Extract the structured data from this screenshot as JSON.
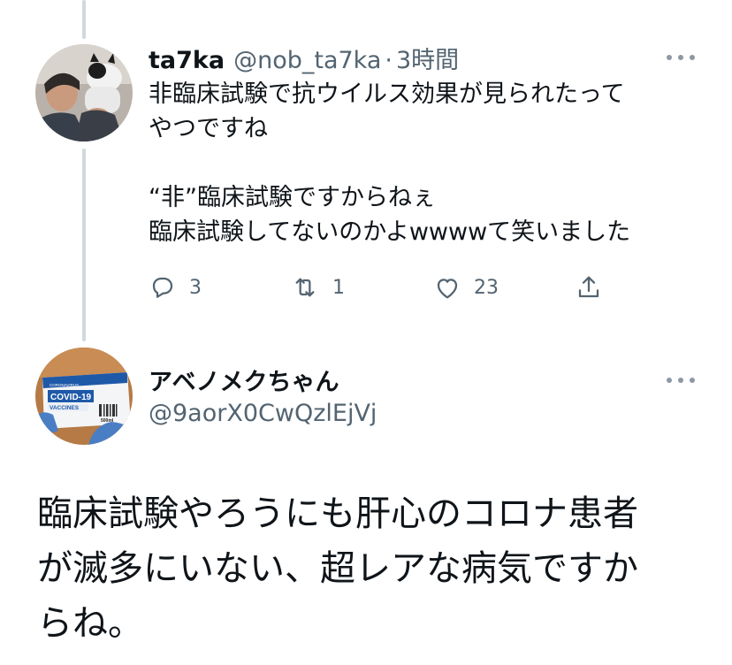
{
  "reply": {
    "display_name": "ta7ka",
    "handle": "@nob_ta7ka",
    "separator": "·",
    "time": "3時間",
    "text_lines": [
      "非臨床試験で抗ウイルス効果が見られたって",
      "やつですね",
      "",
      "“非”臨床試験ですからねぇ",
      "臨床試験してないのかよwwwwて笑いました"
    ],
    "reply_count": "3",
    "retweet_count": "1",
    "like_count": "23",
    "avatar_icon": "person-with-cat-avatar"
  },
  "main_tweet": {
    "display_name": "アベノメクちゃん",
    "handle": "@9aorX0CwQzlEjVj",
    "avatar_icon": "covid-vaccine-box-avatar",
    "avatar_text": {
      "small": "CORONAVIRUS",
      "title": "COVID-19",
      "subtitle": "VACCINES",
      "dose": "500ml"
    },
    "text_lines": [
      "臨床試験やろうにも肝心のコロナ患者",
      "が滅多にいない、超レアな病気ですか",
      "らね。"
    ]
  },
  "colors": {
    "text": "#0f1419",
    "secondary": "#536471",
    "thread_line": "#cfd9de"
  }
}
